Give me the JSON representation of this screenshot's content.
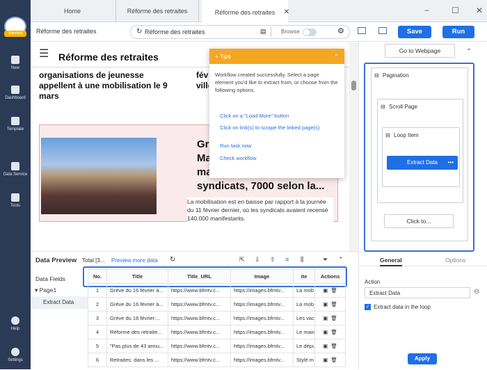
{
  "sidebar": {
    "avatar_badge": "Standard",
    "items": [
      {
        "label": "New",
        "icon": "plus-icon"
      },
      {
        "label": "Dashboard",
        "icon": "dashboard-icon"
      },
      {
        "label": "Template",
        "icon": "template-icon"
      },
      {
        "label": "Data Service",
        "icon": "data-service-icon"
      },
      {
        "label": "Tools",
        "icon": "tools-icon"
      },
      {
        "label": "Help",
        "icon": "help-icon"
      },
      {
        "label": "Settings",
        "icon": "settings-icon"
      }
    ]
  },
  "tabs": [
    "Home",
    "Réforme des retraites",
    "Réforme des retraites"
  ],
  "toolbar": {
    "title": "Réforme des retraites",
    "url": "Réforme des retraites",
    "browse": "Browse",
    "save": "Save",
    "run": "Run"
  },
  "page": {
    "site_title": "Réforme des retraites",
    "headline1": "organisations de jeunesse appellent à une mobilisation le 9 mars",
    "headline1_cut": "févr ville",
    "headline2_lines": [
      "Grè",
      "Ma",
      "ma",
      "syndicats, 7000 selon la..."
    ],
    "snippet": "La mobilisation est en baisse par rapport à la journée du 11 février dernier, où les syndicats avaient recensé 140.000 manifestants."
  },
  "tips": {
    "header": "Tips",
    "body": "Workflow created successfully. Select a page element you'd like to extract from, or choose from the following options.",
    "links": [
      "Click on a \"Load More\" button",
      "Click on link(s) to scrape the linked page(s)",
      "Run task now",
      "Check workflow"
    ]
  },
  "workflow": {
    "goto": "Go to Webpage",
    "pagination": "Pagination",
    "scroll": "Scroll Page",
    "loop": "Loop Item",
    "extract": "Extract Data",
    "click": "Click to...",
    "tab_general": "General",
    "tab_options": "Options",
    "action_label": "Action",
    "action_value": "Extract Data",
    "checkbox_label": "Extract data in the loop",
    "apply": "Apply"
  },
  "preview": {
    "title": "Data Preview",
    "total": "Total [3...",
    "more": "Preview more data",
    "fields_label": "Data Fields",
    "page1": "Page1",
    "extract": "Extract Data",
    "columns": [
      "No.",
      "Title",
      "Title_URL",
      "Image",
      "ite",
      "Actions"
    ],
    "rows": [
      [
        "1",
        "Grève du 16 février à...",
        "https://www.bfmtv.c...",
        "https://images.bfmtv...",
        "La mob"
      ],
      [
        "2",
        "Grève du 16 février à...",
        "https://www.bfmtv.c...",
        "https://images.bfmtv...",
        "La mob"
      ],
      [
        "3",
        "Grève du 16 février:...",
        "https://www.bfmtv.c...",
        "https://images.bfmtv...",
        "Les vaca"
      ],
      [
        "4",
        "Réforme des retraite...",
        "https://www.bfmtv.c...",
        "https://images.bfmtv...",
        "Le maire"
      ],
      [
        "5",
        "\"Pas plus de 43 annu...",
        "https://www.bfmtv.c...",
        "https://images.bfmtv...",
        "Le déput"
      ],
      [
        "6",
        "Retraites: dans les ...",
        "https://www.bfmtv.c...",
        "https://images.bfmtv...",
        "Stylé m"
      ]
    ]
  }
}
